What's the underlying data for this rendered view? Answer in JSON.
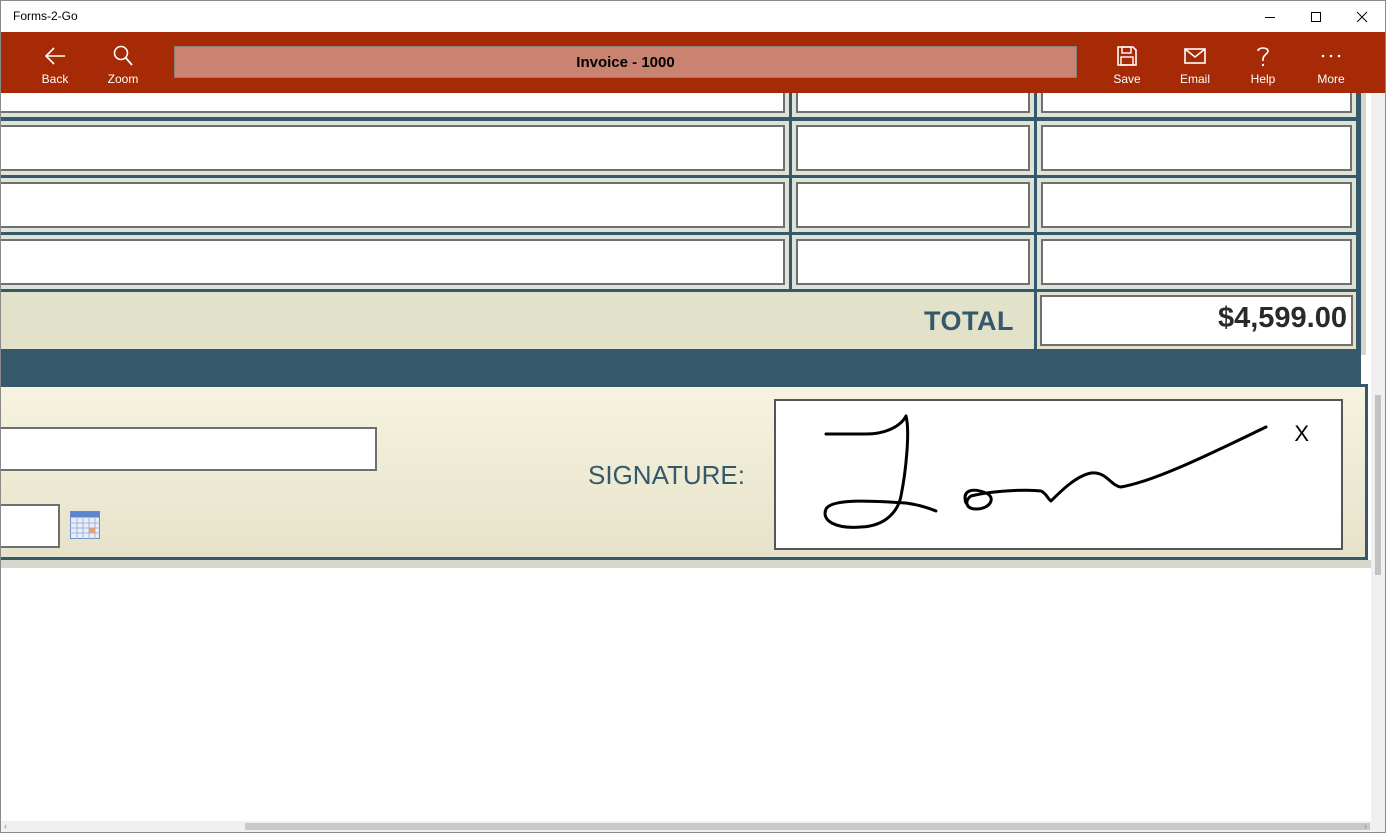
{
  "window": {
    "title": "Forms-2-Go",
    "controls": [
      "minimize-icon",
      "maximize-icon",
      "close-icon"
    ]
  },
  "command_bar": {
    "background": "#a52a05",
    "document_title": "Invoice - 1000",
    "left_buttons": [
      {
        "label": "Back",
        "icon": "back-arrow-icon"
      },
      {
        "label": "Zoom",
        "icon": "search-icon"
      }
    ],
    "right_buttons": [
      {
        "label": "Save",
        "icon": "save-icon"
      },
      {
        "label": "Email",
        "icon": "mail-icon"
      },
      {
        "label": "Help",
        "icon": "help-icon"
      },
      {
        "label": "More",
        "icon": "more-icon"
      }
    ]
  },
  "invoice": {
    "line_items": [
      {
        "description": "",
        "quantity": "",
        "amount": ""
      },
      {
        "description": "",
        "quantity": "",
        "amount": ""
      },
      {
        "description": "",
        "quantity": "",
        "amount": ""
      },
      {
        "description": "",
        "quantity": "",
        "amount": ""
      }
    ],
    "total_label": "TOTAL",
    "total_value": "$4,599.00"
  },
  "signature_section": {
    "name_value": "",
    "date_value": "",
    "calendar_icon": "calendar-icon",
    "signature_label": "SIGNATURE:",
    "clear_label": "X",
    "signature_drawn": true
  },
  "colors": {
    "accent": "#a52a05",
    "frame": "#35586b",
    "panel": "#e2e1c9"
  }
}
